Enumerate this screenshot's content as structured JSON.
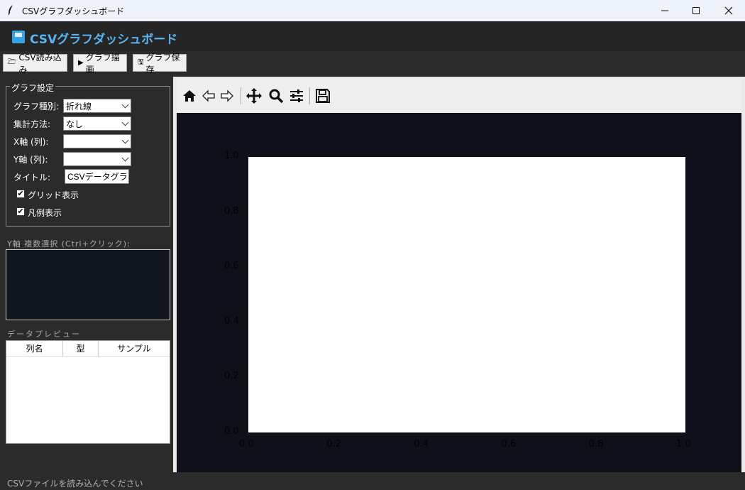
{
  "window": {
    "title": "CSVグラフダッシュボード",
    "minimize": "—",
    "maximize": "☐",
    "close": "✕"
  },
  "header": {
    "title": "CSVグラフダッシュボード"
  },
  "toolbar": {
    "load_label": "CSV読み込み",
    "draw_label": "グラフ描画",
    "save_label": "グラフ保存"
  },
  "settings": {
    "group_title": "グラフ設定",
    "chart_type_label": "グラフ種別:",
    "chart_type_value": "折れ線",
    "aggregation_label": "集計方法:",
    "aggregation_value": "なし",
    "x_axis_label": "X軸 (列):",
    "x_axis_value": "",
    "y_axis_label": "Y軸 (列):",
    "y_axis_value": "",
    "title_label": "タイトル:",
    "title_value": "CSVデータグラフ",
    "grid_label": "グリッド表示",
    "grid_checked": true,
    "legend_label": "凡例表示",
    "legend_checked": true
  },
  "multi_select": {
    "label": "Y軸 複数選択 (Ctrl+クリック):"
  },
  "preview": {
    "label": "データプレビュー",
    "columns": [
      "列名",
      "型",
      "サンプル"
    ]
  },
  "plot_toolbar": {
    "icons": [
      "home-icon",
      "back-icon",
      "forward-icon",
      "pan-icon",
      "zoom-icon",
      "configure-subplots-icon",
      "save-icon"
    ]
  },
  "chart_data": {
    "type": "line",
    "series": [],
    "xlim": [
      0.0,
      1.0
    ],
    "ylim": [
      0.0,
      1.0
    ],
    "x_ticks": [
      "0.0",
      "0.2",
      "0.4",
      "0.6",
      "0.8",
      "1.0"
    ],
    "y_ticks": [
      "0.0",
      "0.2",
      "0.4",
      "0.6",
      "0.8",
      "1.0"
    ]
  },
  "status": {
    "message": "CSVファイルを読み込んでください"
  }
}
